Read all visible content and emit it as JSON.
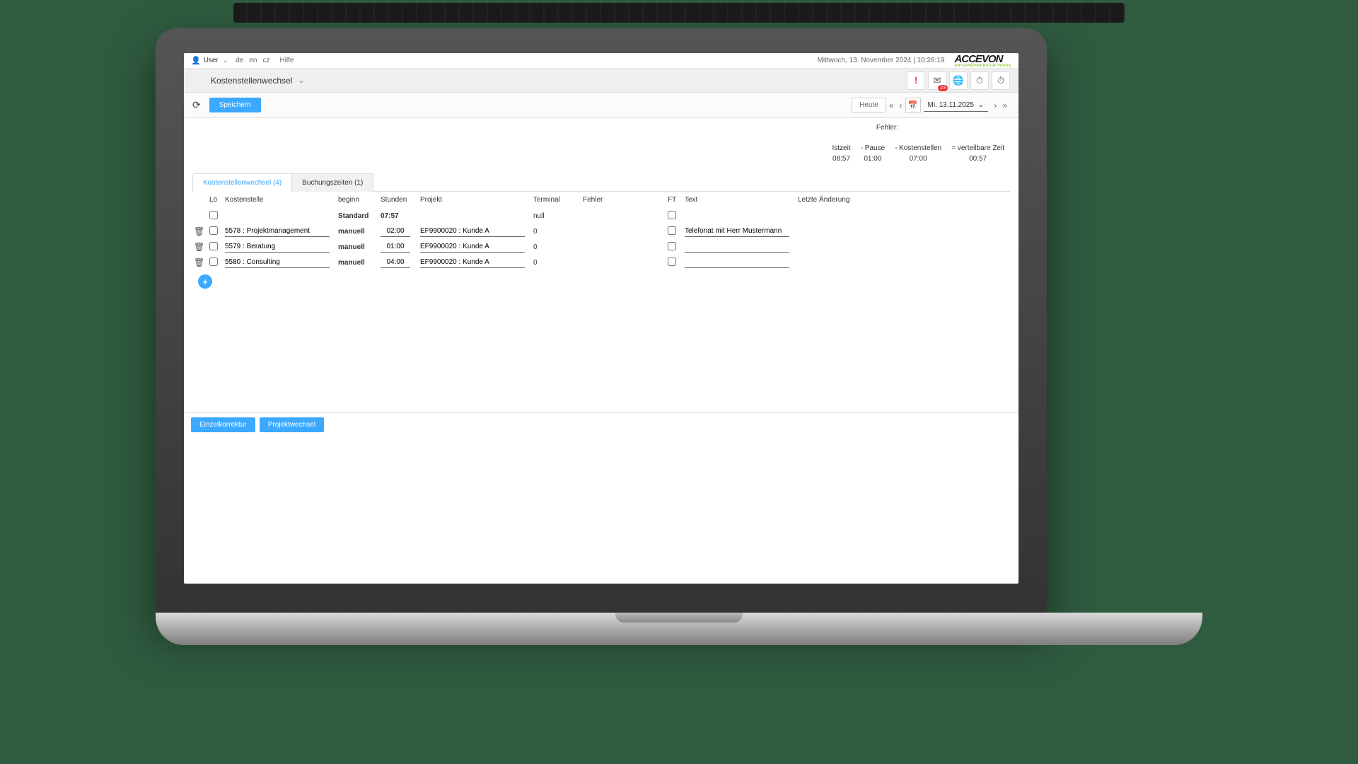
{
  "topbar": {
    "user_label": "User",
    "lang_de": "de",
    "lang_en": "en",
    "lang_cz": "cz",
    "help": "Hilfe",
    "datetime": "Mittwoch, 13. November 2024 | 10:26:19",
    "logo_main": "ACCEVON",
    "logo_sub": "UNTERNEHMENSSOFTWARE"
  },
  "navbar": {
    "title": "Kostenstellenwechsel",
    "icons": {
      "alert": "!",
      "mail_badge": "23"
    }
  },
  "toolbar": {
    "save": "Speichern",
    "today": "Heute",
    "date_display": "Mi. 13.11.2025"
  },
  "summary": {
    "fehler_label": "Fehler:",
    "cols": [
      {
        "label": "Istzeit",
        "value": "08:57"
      },
      {
        "label": "- Pause",
        "value": "01:00"
      },
      {
        "label": "- Kostenstellen",
        "value": "07:00"
      },
      {
        "label": "= verteilbare Zeit",
        "value": "00:57"
      }
    ]
  },
  "tabs": {
    "active": "Kostenstellenwechsel (4)",
    "inactive": "Buchungszeiten (1)"
  },
  "grid": {
    "headers": {
      "loeschen": "Lö",
      "kostenstelle": "Kostenstelle",
      "beginn": "beginn",
      "stunden": "Stunden",
      "projekt": "Projekt",
      "terminal": "Terminal",
      "fehler": "Fehler",
      "ft": "FT",
      "text": "Text",
      "letzte_aenderung": "Letzte Änderung"
    },
    "rows": [
      {
        "trash": false,
        "loeschen": false,
        "kostenstelle": "",
        "beginn": "Standard",
        "stunden": "07:57",
        "projekt": "",
        "terminal": "null",
        "fehler": "",
        "ft": false,
        "text": "",
        "letzte_aenderung": ""
      },
      {
        "trash": true,
        "loeschen": false,
        "kostenstelle": "5578 : Projektmanagement",
        "beginn": "manuell",
        "stunden": "02:00",
        "projekt": "EF9900020 : Kunde A",
        "terminal": "0",
        "fehler": "",
        "ft": false,
        "text": "Telefonat mit Herr Mustermann",
        "letzte_aenderung": ""
      },
      {
        "trash": true,
        "loeschen": false,
        "kostenstelle": "5579 : Beratung",
        "beginn": "manuell",
        "stunden": "01:00",
        "projekt": "EF9900020 : Kunde A",
        "terminal": "0",
        "fehler": "",
        "ft": false,
        "text": "",
        "letzte_aenderung": ""
      },
      {
        "trash": true,
        "loeschen": false,
        "kostenstelle": "5580 : Consulting",
        "beginn": "manuell",
        "stunden": "04:00",
        "projekt": "EF9900020 : Kunde A",
        "terminal": "0",
        "fehler": "",
        "ft": false,
        "text": "",
        "letzte_aenderung": ""
      }
    ]
  },
  "footer": {
    "einzelkorrektur": "Einzelkorrektur",
    "projektwechsel": "Projektwechsel"
  }
}
